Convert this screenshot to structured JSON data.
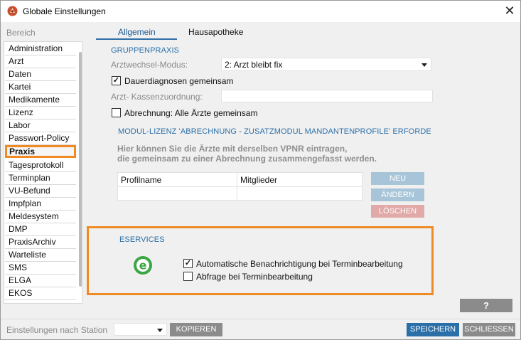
{
  "window": {
    "title": "Globale Einstellungen",
    "close_glyph": "✕"
  },
  "sidebar": {
    "header": "Bereich",
    "items": [
      {
        "label": "Administration"
      },
      {
        "label": "Arzt"
      },
      {
        "label": "Daten"
      },
      {
        "label": "Kartei"
      },
      {
        "label": "Medikamente"
      },
      {
        "label": "Lizenz"
      },
      {
        "label": "Labor"
      },
      {
        "label": "Passwort-Policy"
      },
      {
        "label": "Praxis",
        "selected": true
      },
      {
        "label": "Tagesprotokoll"
      },
      {
        "label": "Terminplan"
      },
      {
        "label": "VU-Befund"
      },
      {
        "label": "Impfplan"
      },
      {
        "label": "Meldesystem"
      },
      {
        "label": "DMP"
      },
      {
        "label": "PraxisArchiv"
      },
      {
        "label": "Warteliste"
      },
      {
        "label": "SMS"
      },
      {
        "label": "ELGA"
      },
      {
        "label": "EKOS"
      }
    ]
  },
  "tabs": [
    {
      "label": "Allgemein",
      "active": true
    },
    {
      "label": "Hausapotheke",
      "active": false
    }
  ],
  "gruppenpraxis": {
    "title": "GRUPPENPRAXIS",
    "arztwechsel_label": "Arztwechsel-Modus:",
    "arztwechsel_value": "2: Arzt bleibt fix",
    "dauerdiagnosen_label": "Dauerdiagnosen gemeinsam",
    "dauerdiagnosen_checked": true,
    "kassen_label": "Arzt- Kassenzuordnung:",
    "kassen_value": "",
    "abrechnung_label": "Abrechnung: Alle Ärzte gemeinsam",
    "abrechnung_checked": false
  },
  "modul": {
    "title": "MODUL-LIZENZ 'ABRECHNUNG - ZUSATZMODUL MANDANTENPROFILE' ERFORDERLICI",
    "info_line1": "Hier können Sie die Ärzte mit derselben VPNR eintragen,",
    "info_line2": "die gemeinsam zu einer Abrechnung zusammengefasst werden.",
    "columns": [
      "Profilname",
      "Mitglieder"
    ],
    "btn_neu": "NEU",
    "btn_aendern": "ÄNDERN",
    "btn_loeschen": "LÖSCHEN"
  },
  "eservices": {
    "title": "ESERVICES",
    "logo_letter": "e",
    "auto_label": "Automatische Benachrichtigung bei Terminbearbeitung",
    "auto_checked": true,
    "abfrage_label": "Abfrage bei Terminbearbeitung",
    "abfrage_checked": false
  },
  "help_label": "?",
  "footer": {
    "station_label": "Einstellungen nach Station",
    "station_value": "",
    "btn_kopieren": "KOPIEREN",
    "btn_speichern": "SPEICHERN",
    "btn_schliessen": "SCHLIESSEN"
  },
  "colors": {
    "accent": "#2b6fa9",
    "highlight": "#f08a24",
    "disabled_blue": "#a7c4d8",
    "disabled_red": "#e1aaa8",
    "grey_button": "#8b8b8b",
    "eservices_green": "#3aa644"
  },
  "icons": {
    "app": "app-logo-icon",
    "close": "close-icon",
    "dropdown": "chevron-down-icon",
    "eservices": "eservices-logo-icon"
  }
}
